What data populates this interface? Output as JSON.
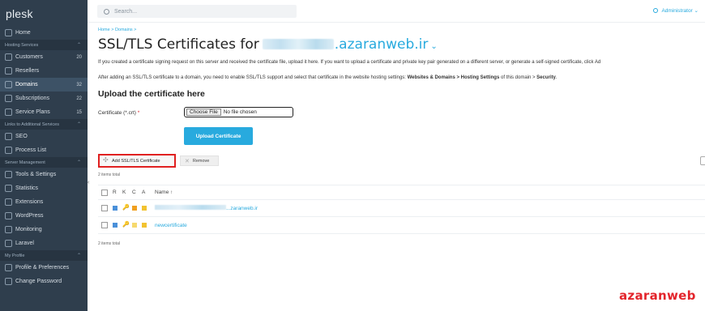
{
  "sidebar": {
    "logo": "plesk",
    "home": "Home",
    "sections": {
      "hosting": "Hosting Services",
      "links": "Links to Additional Services",
      "server": "Server Management",
      "profile": "My Profile"
    },
    "customers": {
      "label": "Customers",
      "count": "20"
    },
    "resellers": {
      "label": "Resellers"
    },
    "domains": {
      "label": "Domains",
      "count": "32"
    },
    "subscriptions": {
      "label": "Subscriptions",
      "count": "22"
    },
    "service_plans": {
      "label": "Service Plans",
      "count": "15"
    },
    "seo": "SEO",
    "process_list": "Process List",
    "tools": "Tools & Settings",
    "statistics": "Statistics",
    "extensions": "Extensions",
    "wordpress": "WordPress",
    "monitoring": "Monitoring",
    "laravel": "Laravel",
    "profile_prefs": "Profile & Preferences",
    "change_password": "Change Password"
  },
  "header": {
    "search_placeholder": "Search...",
    "user": "Administrator"
  },
  "main": {
    "breadcrumb": "Home > Domains >",
    "title_prefix": "SSL/TLS Certificates for",
    "title_domain": ".azaranweb.ir",
    "desc1": "If you created a certificate signing request on this server and received the certificate file, upload it here. If you want to upload a certificate and private key pair generated on a different server, or generate a self-signed certificate, click Ad",
    "desc2_prefix": "After adding an SSL/TLS certificate to a domain, you need to enable SSL/TLS support and select that certificate in the website hosting settings: ",
    "desc2_bold": "Websites & Domains > Hosting Settings",
    "desc2_mid": " of this domain > ",
    "desc2_bold2": "Security",
    "desc2_end": ".",
    "upload_title": "Upload the certificate here",
    "cert_label": "Certificate (*.crt)",
    "cert_required": "*",
    "choose_file": "Choose File",
    "no_file": "No file chosen",
    "upload_button": "Upload Certificate",
    "add_button": "Add SSL/TLS Certificate",
    "remove_button": "Remove",
    "items_total": "2 items total",
    "columns": {
      "r": "R",
      "k": "K",
      "c": "C",
      "a": "A",
      "name": "Name ↑"
    },
    "rows": [
      {
        "name_suffix": "...zaranweb.ir"
      },
      {
        "name": "newcertificate"
      }
    ]
  },
  "watermark": "azaranweb",
  "colors": {
    "sidebar": "#2f3e4d",
    "accent": "#28aade",
    "highlight": "#e02020"
  }
}
